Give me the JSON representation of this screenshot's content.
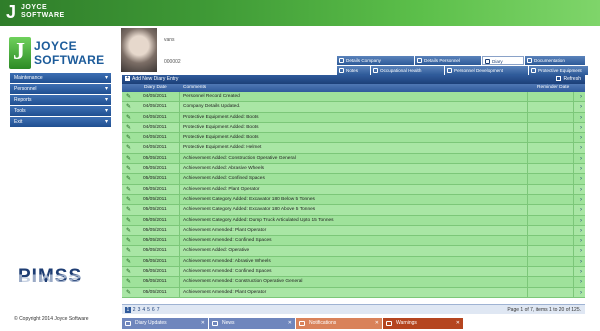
{
  "header": {
    "logo_j": "J",
    "logo_line1": "JOYCE",
    "logo_line2": "SOFTWARE"
  },
  "sidebar": {
    "logo_j": "J",
    "logo_line1": "JOYCE",
    "logo_line2": "SOFTWARE",
    "items": [
      {
        "label": "Maintenance"
      },
      {
        "label": "Personnel"
      },
      {
        "label": "Reports"
      },
      {
        "label": "Tools"
      },
      {
        "label": "Exit"
      }
    ],
    "brand": "PIMSS",
    "copyright": "© Copyright 2014 Joyce Software"
  },
  "employee": {
    "name_fragment": "vans",
    "id_fragment": "000002"
  },
  "tabs_row1": [
    {
      "label": "Details Company",
      "active": false
    },
    {
      "label": "Details Personnel",
      "active": false
    },
    {
      "label": "Diary",
      "active": true
    },
    {
      "label": "Documentation",
      "active": false
    }
  ],
  "tabs_row2": [
    {
      "label": "Notes"
    },
    {
      "label": "Occupational Health"
    },
    {
      "label": "Personnel Development"
    },
    {
      "label": "Protective Equipment"
    }
  ],
  "grid": {
    "add_label": "Add New Diary Entry",
    "refresh_label": "Refresh",
    "columns": {
      "date": "Diary Date",
      "comments": "Comments",
      "reminder": "Reminder Date"
    },
    "rows": [
      {
        "date": "04/05/2011",
        "comment": "Personnel Record Created"
      },
      {
        "date": "04/05/2011",
        "comment": "Company Details Updated."
      },
      {
        "date": "04/05/2011",
        "comment": "Protective Equipment Added: Boots"
      },
      {
        "date": "04/05/2011",
        "comment": "Protective Equipment Added: Boots"
      },
      {
        "date": "04/05/2011",
        "comment": "Protective Equipment Added: Boots"
      },
      {
        "date": "04/05/2011",
        "comment": "Protective Equipment Added: Helmet"
      },
      {
        "date": "05/05/2011",
        "comment": "Achievement Added: Construction Operative General"
      },
      {
        "date": "05/05/2011",
        "comment": "Achievement Added: Abrasive Wheels"
      },
      {
        "date": "05/05/2011",
        "comment": "Achievement Added: Confined Spaces"
      },
      {
        "date": "05/05/2011",
        "comment": "Achievement Added: Plant Operator"
      },
      {
        "date": "05/05/2011",
        "comment": "Achievement Category Added: Excavator 180 Below 5 Tonnes"
      },
      {
        "date": "05/05/2011",
        "comment": "Achievement Category Added: Excavator 180 Above 5 Tonnes"
      },
      {
        "date": "05/05/2011",
        "comment": "Achievement Category Added: Dump Truck Articulated Upto 15 Tonnes"
      },
      {
        "date": "05/05/2011",
        "comment": "Achievement Amended: Plant Operator"
      },
      {
        "date": "05/05/2011",
        "comment": "Achievement Amended: Confined Spaces"
      },
      {
        "date": "05/05/2011",
        "comment": "Achievement Added: Operative"
      },
      {
        "date": "05/05/2011",
        "comment": "Achievement Amended: Abrasive Wheels"
      },
      {
        "date": "05/05/2011",
        "comment": "Achievement Amended: Confined Spaces"
      },
      {
        "date": "05/05/2011",
        "comment": "Achievement Amended: Construction Operative General"
      },
      {
        "date": "05/05/2011",
        "comment": "Achievement Amended: Plant Operator"
      }
    ],
    "pager": {
      "pages": [
        "1",
        "2",
        "3",
        "4",
        "5",
        "6",
        "7"
      ],
      "current": "1",
      "info": "Page 1 of 7, items 1 to 20 of 125."
    }
  },
  "bottom_tabs": [
    {
      "label": "Diary Updates",
      "color": "#6f86bd"
    },
    {
      "label": "News",
      "color": "#6f86bd"
    },
    {
      "label": "Notifications",
      "color": "#d9825a"
    },
    {
      "label": "Warnings",
      "color": "#b5451f"
    }
  ],
  "icons": {
    "edit": "pencil-icon",
    "row_arrow": "chevron-right-icon",
    "nav_chevron": "chevron-down-icon"
  }
}
